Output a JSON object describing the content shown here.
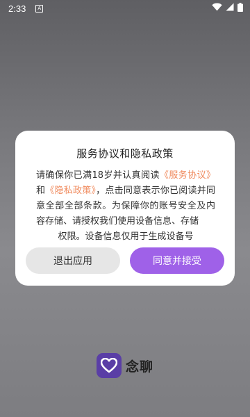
{
  "status_bar": {
    "time": "2:33",
    "notification_icon": "A"
  },
  "dialog": {
    "title": "服务协议和隐私政策",
    "body_prefix": "请确保你已满18岁并认真阅读",
    "service_agreement_link": "《服务协议》",
    "body_and": "和",
    "privacy_policy_link": "《隐私政策》",
    "body_rest": "，点击同意表示你已阅读并同意全部全部条款。为保障你的账号安全及内容存储、请授权我们使用设备信息、存储",
    "body_last_line": "权限。设备信息仅用于生成设备号",
    "exit_button_label": "退出应用",
    "agree_button_label": "同意并接受"
  },
  "brand": {
    "app_name": "念聊"
  },
  "colors": {
    "accent": "#9f61e8",
    "link": "#f08a5d",
    "logo_bg": "#5a3ea6"
  }
}
